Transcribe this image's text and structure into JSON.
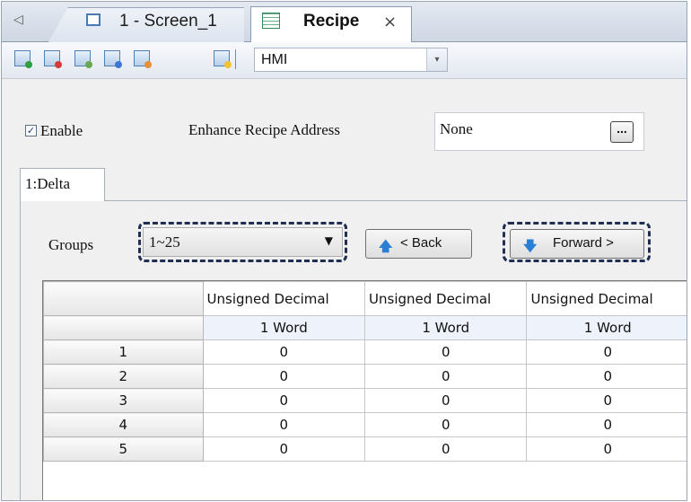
{
  "tabs": {
    "scroll_left_icon": "◁",
    "items": [
      {
        "label": "1 - Screen_1",
        "icon": "screen-icon",
        "active": false
      },
      {
        "label": "Recipe",
        "icon": "recipe-table-icon",
        "active": true,
        "close": "×"
      }
    ]
  },
  "toolbar": {
    "buttons": [
      "add-recipe-icon",
      "delete-recipe-icon",
      "import-icon",
      "export-icon",
      "paint-icon",
      "edit-icon"
    ],
    "device_select": {
      "value": "HMI",
      "arrow": "▾"
    }
  },
  "settings": {
    "enable_label": "Enable",
    "enable_checked": true,
    "check_mark": "✓",
    "enhance_label": "Enhance Recipe Address",
    "enhance_value": "None",
    "browse_label": "..."
  },
  "sheet_tab": {
    "label": "1:Delta"
  },
  "groups": {
    "label": "Groups",
    "value": "1~25",
    "arrow": "▼",
    "back_icon": "🡅",
    "back_label": "< Back",
    "forward_icon": "🡇",
    "forward_label": "Forward >"
  },
  "grid": {
    "columns": [
      "Unsigned Decimal",
      "Unsigned Decimal",
      "Unsigned Decimal"
    ],
    "sizes": [
      "1 Word",
      "1 Word",
      "1 Word"
    ],
    "rows": [
      {
        "label": "1",
        "values": [
          "0",
          "0",
          "0"
        ]
      },
      {
        "label": "2",
        "values": [
          "0",
          "0",
          "0"
        ]
      },
      {
        "label": "3",
        "values": [
          "0",
          "0",
          "0"
        ]
      },
      {
        "label": "4",
        "values": [
          "0",
          "0",
          "0"
        ]
      },
      {
        "label": "5",
        "values": [
          "0",
          "0",
          "0"
        ]
      }
    ]
  },
  "colors": {
    "highlight_border": "#1f2e52",
    "arrow_blue": "#2a7fd4"
  }
}
